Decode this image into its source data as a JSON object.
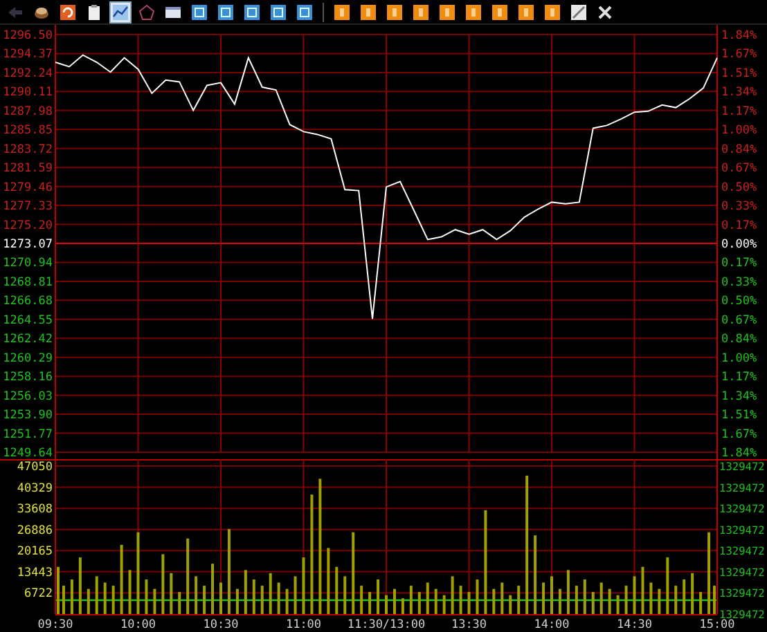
{
  "toolbar": {
    "buttons": [
      {
        "kind": "back",
        "selected": false
      },
      {
        "kind": "coins",
        "selected": false
      },
      {
        "kind": "refresh",
        "selected": false
      },
      {
        "kind": "clipboard",
        "selected": false
      },
      {
        "kind": "chart",
        "selected": true
      },
      {
        "kind": "radar",
        "selected": false
      },
      {
        "kind": "window",
        "selected": false
      },
      {
        "kind": "blue",
        "selected": false
      },
      {
        "kind": "blue",
        "selected": false
      },
      {
        "kind": "blue",
        "selected": false
      },
      {
        "kind": "blue",
        "selected": false
      },
      {
        "kind": "blue",
        "selected": false
      },
      {
        "kind": "orange",
        "selected": false
      },
      {
        "kind": "orange",
        "selected": false
      },
      {
        "kind": "orange",
        "selected": false
      },
      {
        "kind": "orange",
        "selected": false
      },
      {
        "kind": "orange",
        "selected": false
      },
      {
        "kind": "orange",
        "selected": false
      },
      {
        "kind": "orange",
        "selected": false
      },
      {
        "kind": "orange",
        "selected": false
      },
      {
        "kind": "orange",
        "selected": false
      },
      {
        "kind": "pencil",
        "selected": false
      },
      {
        "kind": "close",
        "selected": false
      }
    ]
  },
  "price_panel": {
    "percent_labels": [
      "1.84%",
      "1.67%",
      "1.51%",
      "1.34%",
      "1.17%",
      "1.00%",
      "0.84%",
      "0.67%",
      "0.50%",
      "0.33%",
      "0.17%",
      "0.00%",
      "0.17%",
      "0.33%",
      "0.50%",
      "0.67%",
      "0.84%",
      "1.00%",
      "1.17%",
      "1.34%",
      "1.51%",
      "1.67%",
      "1.84%"
    ],
    "chart_data": {
      "type": "line",
      "grid": true,
      "ylim": [
        1249.64,
        1296.5
      ],
      "yticks": [
        {
          "value": 1296.5,
          "label": "1296.50"
        },
        {
          "value": 1294.37,
          "label": "1294.37"
        },
        {
          "value": 1292.24,
          "label": "1292.24"
        },
        {
          "value": 1290.11,
          "label": "1290.11"
        },
        {
          "value": 1287.98,
          "label": "1287.98"
        },
        {
          "value": 1285.85,
          "label": "1285.85"
        },
        {
          "value": 1283.72,
          "label": "1283.72"
        },
        {
          "value": 1281.59,
          "label": "1281.59"
        },
        {
          "value": 1279.46,
          "label": "1279.46"
        },
        {
          "value": 1277.33,
          "label": "1277.33"
        },
        {
          "value": 1275.2,
          "label": "1275.20"
        },
        {
          "value": 1273.07,
          "label": "1273.07"
        },
        {
          "value": 1270.94,
          "label": "1270.94"
        },
        {
          "value": 1268.81,
          "label": "1268.81"
        },
        {
          "value": 1266.68,
          "label": "1266.68"
        },
        {
          "value": 1264.55,
          "label": "1264.55"
        },
        {
          "value": 1262.42,
          "label": "1262.42"
        },
        {
          "value": 1260.29,
          "label": "1260.29"
        },
        {
          "value": 1258.16,
          "label": "1258.16"
        },
        {
          "value": 1256.03,
          "label": "1256.03"
        },
        {
          "value": 1253.9,
          "label": "1253.90"
        },
        {
          "value": 1251.77,
          "label": "1251.77"
        },
        {
          "value": 1249.64,
          "label": "1249.64"
        }
      ],
      "categories": [
        null,
        null,
        null,
        null,
        null,
        null,
        null,
        null,
        null,
        null,
        null,
        null,
        null,
        null,
        null,
        null,
        null,
        null,
        null,
        null,
        null,
        null,
        null,
        null,
        null,
        null,
        null,
        null,
        null,
        null,
        null,
        null,
        null,
        null,
        null,
        null,
        null,
        null,
        null,
        null,
        null,
        null,
        null,
        null,
        null,
        null,
        null,
        null,
        null
      ],
      "series": [
        {
          "color": "#ffffff",
          "values": [
            1293.4,
            1292.9,
            1294.2,
            1293.4,
            1292.3,
            1293.9,
            1292.6,
            1289.9,
            1291.4,
            1291.2,
            1288,
            1290.8,
            1291.1,
            1288.7,
            1293.9,
            1290.6,
            1290.3,
            1286.4,
            1285.6,
            1285.3,
            1284.8,
            1279.1,
            1279,
            1264.6,
            1279.4,
            1280,
            1276.8,
            1273.5,
            1273.8,
            1274.6,
            1274.1,
            1274.6,
            1273.5,
            1274.5,
            1276,
            1276.9,
            1277.7,
            1277.5,
            1277.7,
            1286,
            1286.3,
            1287,
            1287.8,
            1287.9,
            1288.6,
            1288.3,
            1289.3,
            1290.5,
            1293.9
          ]
        }
      ]
    }
  },
  "volume_panel": {
    "right_labels": [
      "1329472",
      "1329472",
      "1329472",
      "1329472",
      "1329472",
      "1329472",
      "1329472",
      "1329472"
    ],
    "chart_data": {
      "type": "bar",
      "grid": true,
      "ylim": [
        0,
        47050
      ],
      "categories": [
        "09:30",
        null,
        null,
        null,
        null,
        null,
        null,
        null,
        null,
        null,
        "10:00",
        null,
        null,
        null,
        null,
        null,
        null,
        null,
        null,
        null,
        "10:30",
        null,
        null,
        null,
        null,
        null,
        null,
        null,
        null,
        null,
        "11:00",
        null,
        null,
        null,
        null,
        null,
        null,
        null,
        null,
        null,
        "11:30/13:00",
        null,
        null,
        null,
        null,
        null,
        null,
        null,
        null,
        null,
        "13:30",
        null,
        null,
        null,
        null,
        null,
        null,
        null,
        null,
        null,
        "14:00",
        null,
        null,
        null,
        null,
        null,
        null,
        null,
        null,
        null,
        "14:30",
        null,
        null,
        null,
        null,
        null,
        null,
        null,
        null,
        null,
        "15:00"
      ],
      "yticks": [
        {
          "value": 47050,
          "label": "47050"
        },
        {
          "value": 40329,
          "label": "40329"
        },
        {
          "value": 33608,
          "label": "33608"
        },
        {
          "value": 26886,
          "label": "26886"
        },
        {
          "value": 20165,
          "label": "20165"
        },
        {
          "value": 13443,
          "label": "13443"
        },
        {
          "value": 6722,
          "label": "6722"
        }
      ],
      "series": [
        {
          "color": "#a0a000",
          "values": [
            15000,
            9000,
            11000,
            18000,
            8000,
            12000,
            10000,
            9000,
            22000,
            14000,
            26000,
            11000,
            8000,
            19000,
            13000,
            7000,
            24000,
            12000,
            9000,
            16000,
            10000,
            27000,
            8000,
            14000,
            11000,
            9000,
            13000,
            10000,
            8000,
            12000,
            18000,
            38000,
            43000,
            21000,
            15000,
            12000,
            26000,
            9000,
            7000,
            11000,
            6000,
            8000,
            5000,
            9000,
            7000,
            10000,
            8000,
            6000,
            12000,
            9000,
            7000,
            11000,
            33000,
            8000,
            10000,
            6000,
            9000,
            44000,
            25000,
            10000,
            12000,
            8000,
            14000,
            9000,
            11000,
            7000,
            10000,
            8000,
            6000,
            9000,
            12000,
            15000,
            10000,
            8000,
            18000,
            9000,
            11000,
            13000,
            7000,
            26000,
            9000
          ]
        }
      ]
    }
  }
}
